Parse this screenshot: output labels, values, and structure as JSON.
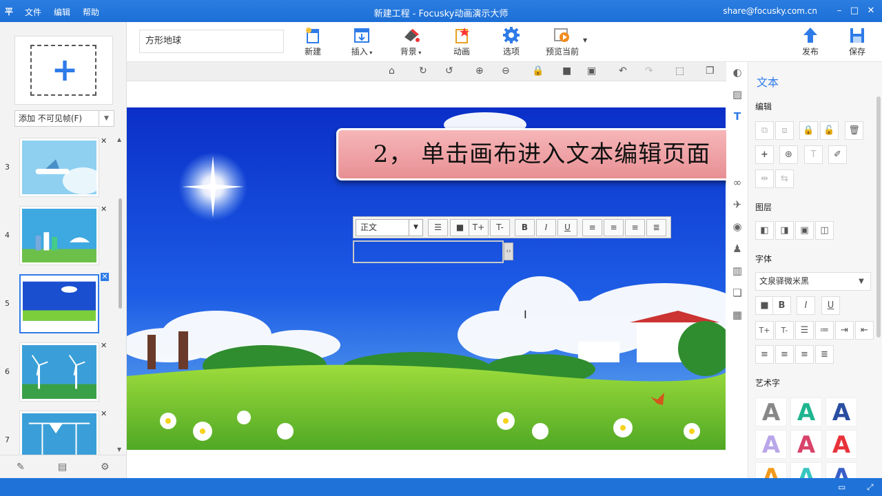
{
  "titlebar": {
    "logo": "平",
    "menu": [
      "文件",
      "编辑",
      "帮助"
    ],
    "title": "新建工程 - Focusky动画演示大师",
    "email": "share@focusky.com.cn",
    "minimize": "–",
    "maximize": "□",
    "close": "✕"
  },
  "left": {
    "add_plus": "+",
    "add_select": "添加 不可见帧(F)",
    "slides": [
      {
        "num": "3"
      },
      {
        "num": "4"
      },
      {
        "num": "5",
        "active": true
      },
      {
        "num": "6"
      },
      {
        "num": "7"
      }
    ]
  },
  "toolbar": {
    "project_name": "方形地球",
    "buttons": [
      {
        "label": "新建",
        "icon": "new-icon"
      },
      {
        "label": "插入",
        "icon": "insert-icon"
      },
      {
        "label": "背景",
        "icon": "background-icon"
      },
      {
        "label": "动画",
        "icon": "animation-icon"
      },
      {
        "label": "选项",
        "icon": "gear-icon"
      },
      {
        "label": "预览当前",
        "icon": "preview-icon"
      },
      {
        "label": "发布",
        "icon": "publish-icon"
      },
      {
        "label": "保存",
        "icon": "save-icon"
      }
    ]
  },
  "canvas": {
    "banner": "2，  单击画布进入文本编辑页面",
    "fmt_style": "正文",
    "fmt_buttons": [
      "☰",
      "■",
      "T+",
      "T-",
      "B",
      "I",
      "U",
      "≡",
      "≡",
      "≡",
      "≣"
    ]
  },
  "right": {
    "title": "文本",
    "sections": {
      "edit": "编辑",
      "layer": "图层",
      "font": "字体",
      "art": "艺术字"
    },
    "font_name": "文泉驿微米黑",
    "style_buttons": [
      "B",
      "I",
      "U"
    ],
    "art_letter": "A"
  },
  "colors": {
    "accent": "#2e7be8",
    "titlebar": "#1c6fd6",
    "banner": "#f0a4a7"
  }
}
